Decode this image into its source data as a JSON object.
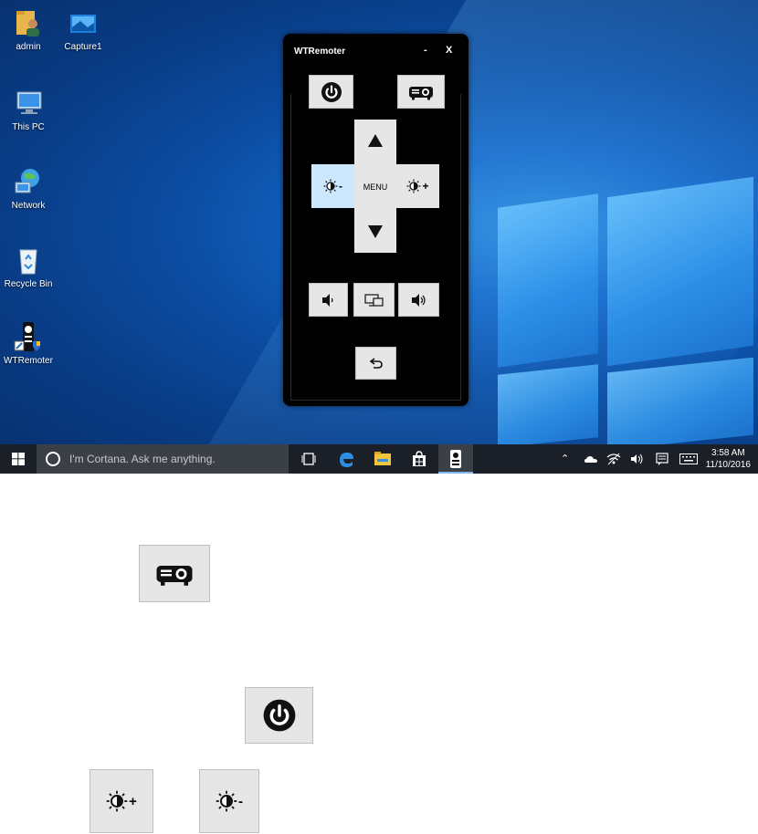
{
  "desktop": {
    "icons": [
      {
        "label": "admin",
        "icon": "folder-user-icon"
      },
      {
        "label": "Capture1",
        "icon": "image-file-icon"
      },
      {
        "label": "This PC",
        "icon": "computer-icon"
      },
      {
        "label": "Network",
        "icon": "network-icon"
      },
      {
        "label": "Recycle Bin",
        "icon": "recycle-bin-icon"
      },
      {
        "label": "WTRemoter",
        "icon": "wtremoter-shortcut-icon"
      }
    ]
  },
  "remote": {
    "title": "WTRemoter",
    "minimize_label": "-",
    "close_label": "X",
    "menu_label": "MENU",
    "brightness_minus_label": "-",
    "brightness_plus_label": "+",
    "buttons": [
      "power-icon",
      "projector-icon",
      "arrow-up-icon",
      "arrow-down-icon",
      "brightness-down-icon",
      "brightness-up-icon",
      "volume-down-icon",
      "source-switch-icon",
      "volume-up-icon",
      "back-icon"
    ]
  },
  "taskbar": {
    "search_placeholder": "I'm Cortana. Ask me anything.",
    "time": "3:58 AM",
    "date": "11/10/2016"
  },
  "colors": {
    "window_bg": "#000000",
    "button_bg": "#e6e6e6",
    "button_active_bg": "#cce8ff",
    "taskbar_bg": "#1b1f27"
  }
}
